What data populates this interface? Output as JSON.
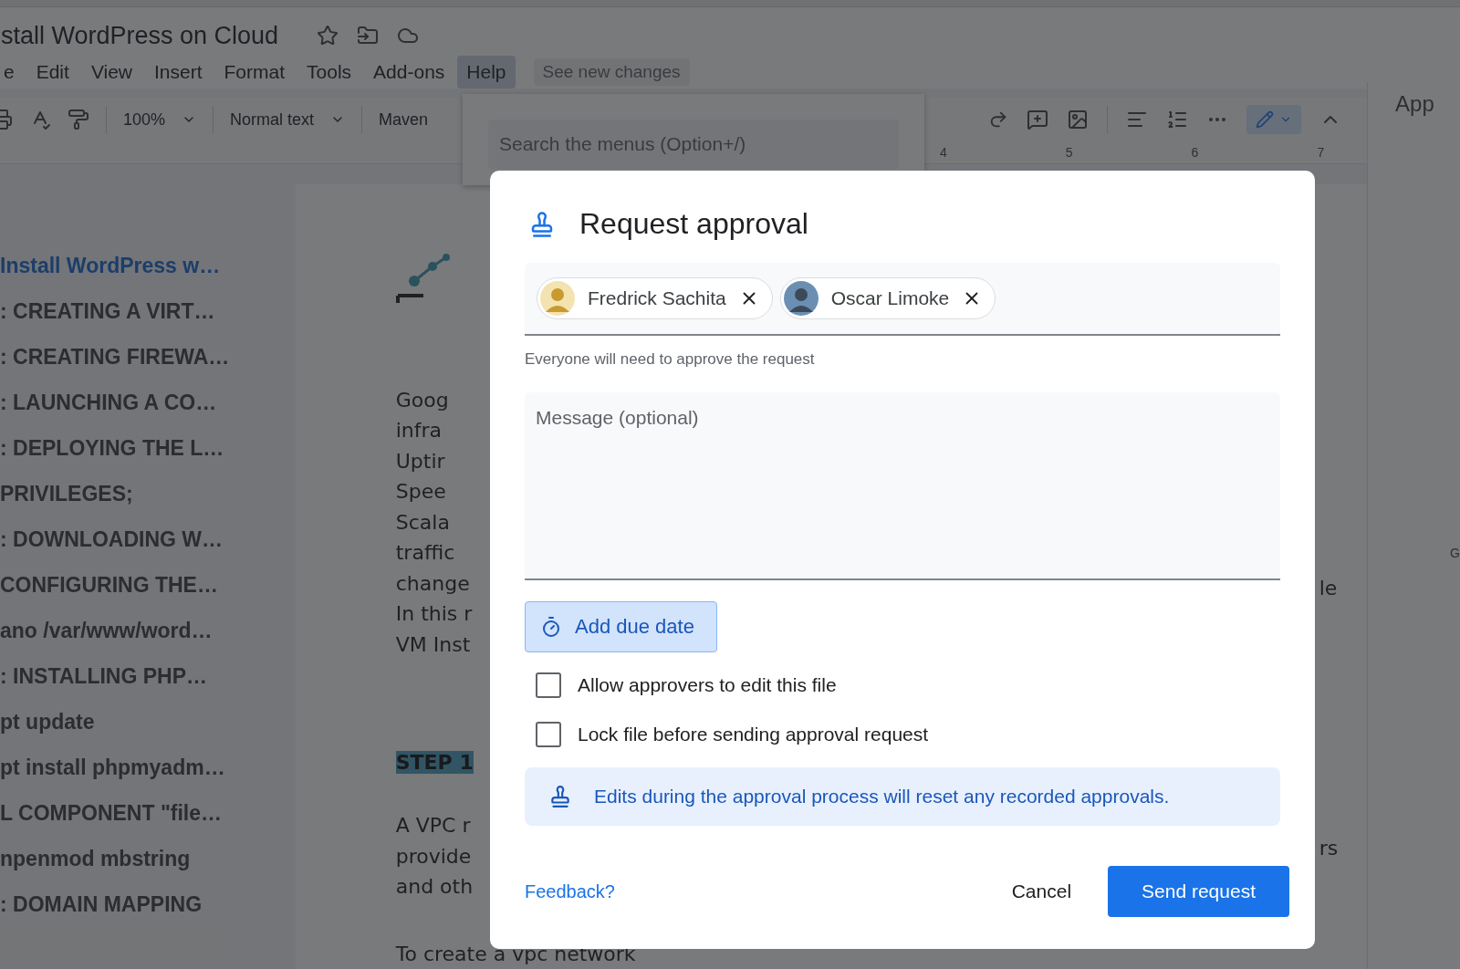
{
  "document": {
    "title": "stall WordPress on Cloud"
  },
  "menu": [
    {
      "label": "e",
      "selected": false
    },
    {
      "label": "Edit",
      "selected": false
    },
    {
      "label": "View",
      "selected": false
    },
    {
      "label": "Insert",
      "selected": false
    },
    {
      "label": "Format",
      "selected": false
    },
    {
      "label": "Tools",
      "selected": false
    },
    {
      "label": "Add-ons",
      "selected": false
    },
    {
      "label": "Help",
      "selected": true
    }
  ],
  "see_new_changes": "See new changes",
  "toolbar": {
    "zoom": "100%",
    "style": "Normal text",
    "font": "Maven"
  },
  "ruler": [
    "4",
    "5",
    "6",
    "7"
  ],
  "menu_search": {
    "placeholder": "Search the menus (Option+/)"
  },
  "outline": [
    {
      "label": "Install WordPress w…",
      "selected": true
    },
    {
      "label": ": CREATING A VIRT…",
      "selected": false
    },
    {
      "label": ": CREATING FIREWA…",
      "selected": false
    },
    {
      "label": ": LAUNCHING A CO…",
      "selected": false
    },
    {
      "label": ": DEPLOYING THE L…",
      "selected": false
    },
    {
      "label": "PRIVILEGES;",
      "selected": false
    },
    {
      "label": ": DOWNLOADING W…",
      "selected": false
    },
    {
      "label": "CONFIGURING THE…",
      "selected": false
    },
    {
      "label": "ano /var/www/word…",
      "selected": false
    },
    {
      "label": ": INSTALLING PHP…",
      "selected": false
    },
    {
      "label": "pt update",
      "selected": false
    },
    {
      "label": "pt install phpmyadm…",
      "selected": false
    },
    {
      "label": "L COMPONENT \"file…",
      "selected": false
    },
    {
      "label": "npenmod mbstring",
      "selected": false
    },
    {
      "label": ": DOMAIN MAPPING",
      "selected": false
    }
  ],
  "page": {
    "lines": [
      "Goog",
      "infra",
      "Uptir",
      "Spee",
      "Scala",
      "traffic",
      "change",
      "In this r",
      "VM Inst"
    ],
    "heading": "STEP 1",
    "lines_2": [
      "A VPC r",
      "provide",
      "and oth"
    ],
    "last_line": "To create a vpc network",
    "right_fragments": [
      "le",
      "rs"
    ]
  },
  "side_panel": {
    "title": "App",
    "letter": "G"
  },
  "dialog": {
    "title": "Request approval",
    "approvers": [
      {
        "name": "Fredrick Sachita"
      },
      {
        "name": "Oscar Limoke"
      }
    ],
    "hint": "Everyone will need to approve the request",
    "message": {
      "placeholder": "Message (optional)"
    },
    "due_date": "Add due date",
    "options": [
      {
        "label": "Allow approvers to edit this file",
        "checked": false
      },
      {
        "label": "Lock file before sending approval request",
        "checked": false
      }
    ],
    "notice": "Edits during the approval process will reset any recorded approvals.",
    "feedback": "Feedback?",
    "cancel": "Cancel",
    "send": "Send request"
  }
}
